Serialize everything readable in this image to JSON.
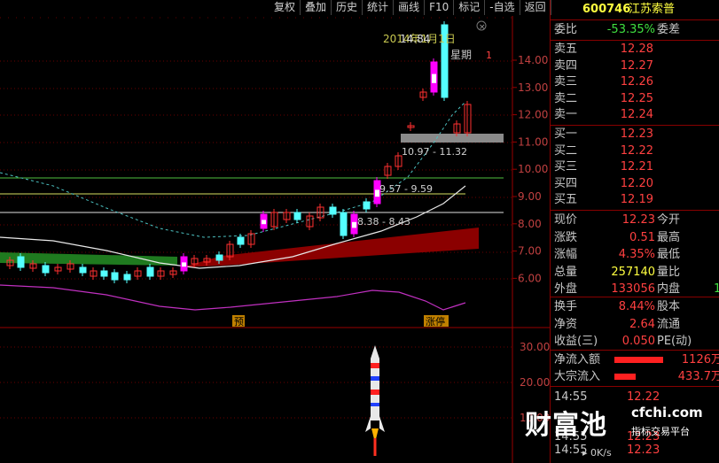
{
  "toolbar": [
    "复权",
    "叠加",
    "历史",
    "统计",
    "画线",
    "F10",
    "标记",
    "-自选",
    "返回"
  ],
  "stock": {
    "code": "600746",
    "name": "江苏索普"
  },
  "wei": {
    "bi_label": "委比",
    "bi_value": "-53.35%",
    "cha_label": "委差"
  },
  "sells": [
    {
      "label": "卖五",
      "price": "12.28"
    },
    {
      "label": "卖四",
      "price": "12.27"
    },
    {
      "label": "卖三",
      "price": "12.26"
    },
    {
      "label": "卖二",
      "price": "12.25"
    },
    {
      "label": "卖一",
      "price": "12.24"
    }
  ],
  "buys": [
    {
      "label": "买一",
      "price": "12.23"
    },
    {
      "label": "买二",
      "price": "12.22"
    },
    {
      "label": "买三",
      "price": "12.21"
    },
    {
      "label": "买四",
      "price": "12.20"
    },
    {
      "label": "买五",
      "price": "12.19"
    }
  ],
  "quote": [
    {
      "label": "现价",
      "value": "12.23",
      "label2": "今开"
    },
    {
      "label": "涨跌",
      "value": "0.51",
      "label2": "最高"
    },
    {
      "label": "涨幅",
      "value": "4.35%",
      "label2": "最低"
    },
    {
      "label": "总量",
      "value": "257140",
      "label2": "量比"
    },
    {
      "label": "外盘",
      "value": "133056",
      "label2": "内盘",
      "extra": "1"
    }
  ],
  "quote2": [
    {
      "label": "换手",
      "value": "8.44%",
      "label2": "股本"
    },
    {
      "label": "净资",
      "value": "2.64",
      "label2": "流通"
    },
    {
      "label": "收益(三)",
      "value": "0.050",
      "label2": "PE(动)"
    }
  ],
  "flows": [
    {
      "label": "净流入额",
      "value": "1126万",
      "bar": 0.78
    },
    {
      "label": "大宗流入",
      "value": "433.7万",
      "bar": 0.34
    }
  ],
  "ticks": [
    {
      "time": "14:55",
      "price": "12.22"
    },
    {
      "time": "",
      "price": ""
    },
    {
      "time": "",
      "price": ""
    },
    {
      "time": "14:55",
      "price": "12.23"
    },
    {
      "time": "14:55",
      "price": "12.23"
    }
  ],
  "status": {
    "speed": "0K/s"
  },
  "chart_texts": {
    "date_label": "2014年1月1日",
    "top_price": "14.84",
    "week": "星期",
    "one": "1",
    "band1": "10.97 - 11.32",
    "band2": "9.57 - 9.59",
    "band3": "8.38 - 8.43",
    "tag_pre": "预",
    "tag_limit": "涨停"
  },
  "price_axis": [
    "14.00",
    "13.00",
    "12.00",
    "11.00",
    "10.00",
    "9.00",
    "8.00",
    "7.00",
    "6.00"
  ],
  "sub_axis": [
    "30.00",
    "20.00",
    "10.00"
  ],
  "watermark": {
    "brand": "财富池",
    "site": "cfchi.com",
    "slogan": "指标交易平台"
  },
  "colors": {
    "up": "#ff3030",
    "down": "#54ffff",
    "highlight": "#ff00ff",
    "volume": "#8b0000",
    "cyan_line": "#4cc0c0"
  }
}
